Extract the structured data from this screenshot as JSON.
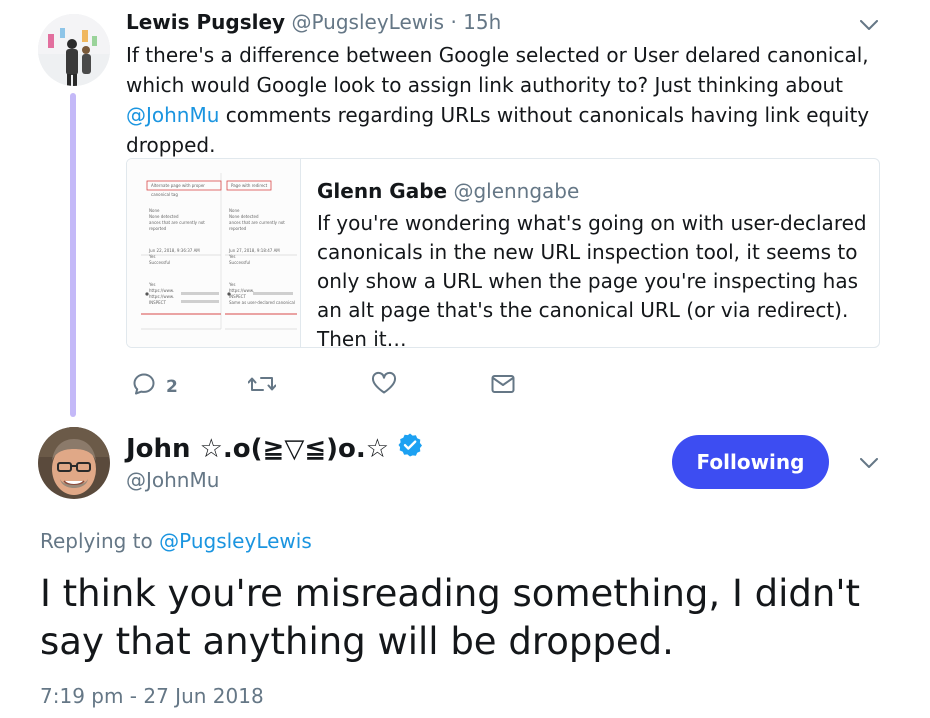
{
  "parent_tweet": {
    "author_name": "Lewis Pugsley",
    "author_handle": "@PugsleyLewis",
    "separator": " · ",
    "time_ago": "15h",
    "text_before": "If there's a difference between Google selected or User delared canonical, which would Google look to assign link authority to? Just thinking about ",
    "mention": "@JohnMu",
    "text_after": " comments regarding URLs without canonicals having link equity dropped."
  },
  "quoted_tweet": {
    "author_name": "Glenn Gabe",
    "author_handle": "@glenngabe",
    "text": "If you're wondering what's going on with user-declared canonicals in the new URL inspection tool, it seems to only show a URL when the page you're inspecting has an alt page that's the canonical URL (or via redirect). Then it…",
    "thumb": {
      "left_box_label": "Alternate page with proper canonical tag",
      "right_box_label": "Page with redirect",
      "rows_left": [
        "None",
        "None detected",
        "ances that are currently not reported",
        "Jun 22, 2018, 9:36:37 AM",
        "Yes",
        "Successful",
        "Yes",
        "https://www.",
        "https://www.",
        "INSPECT"
      ],
      "rows_right": [
        "None",
        "None detected",
        "ances that are currently not reported",
        "Jun 27, 2018, 9:18:47 AM",
        "Yes",
        "Successful",
        "Yes",
        "https://www.",
        "INSPECT",
        "Same as user-declared canonical"
      ]
    }
  },
  "actions": {
    "reply_count": "2"
  },
  "main_tweet": {
    "author_name": "John ☆.o(≧▽≦)o.☆",
    "author_handle": "@JohnMu",
    "follow_label": "Following",
    "replying_prefix": "Replying to ",
    "replying_to": "@PugsleyLewis",
    "text": "I think you're misreading something, I didn't say that anything will be dropped.",
    "timestamp": "7:19 pm - 27 Jun 2018"
  },
  "colors": {
    "link": "#1b95e0",
    "follow_button": "#3d4df2",
    "thread_line": "#c4b9f8",
    "muted": "#657786",
    "verified": "#1da1f2"
  }
}
